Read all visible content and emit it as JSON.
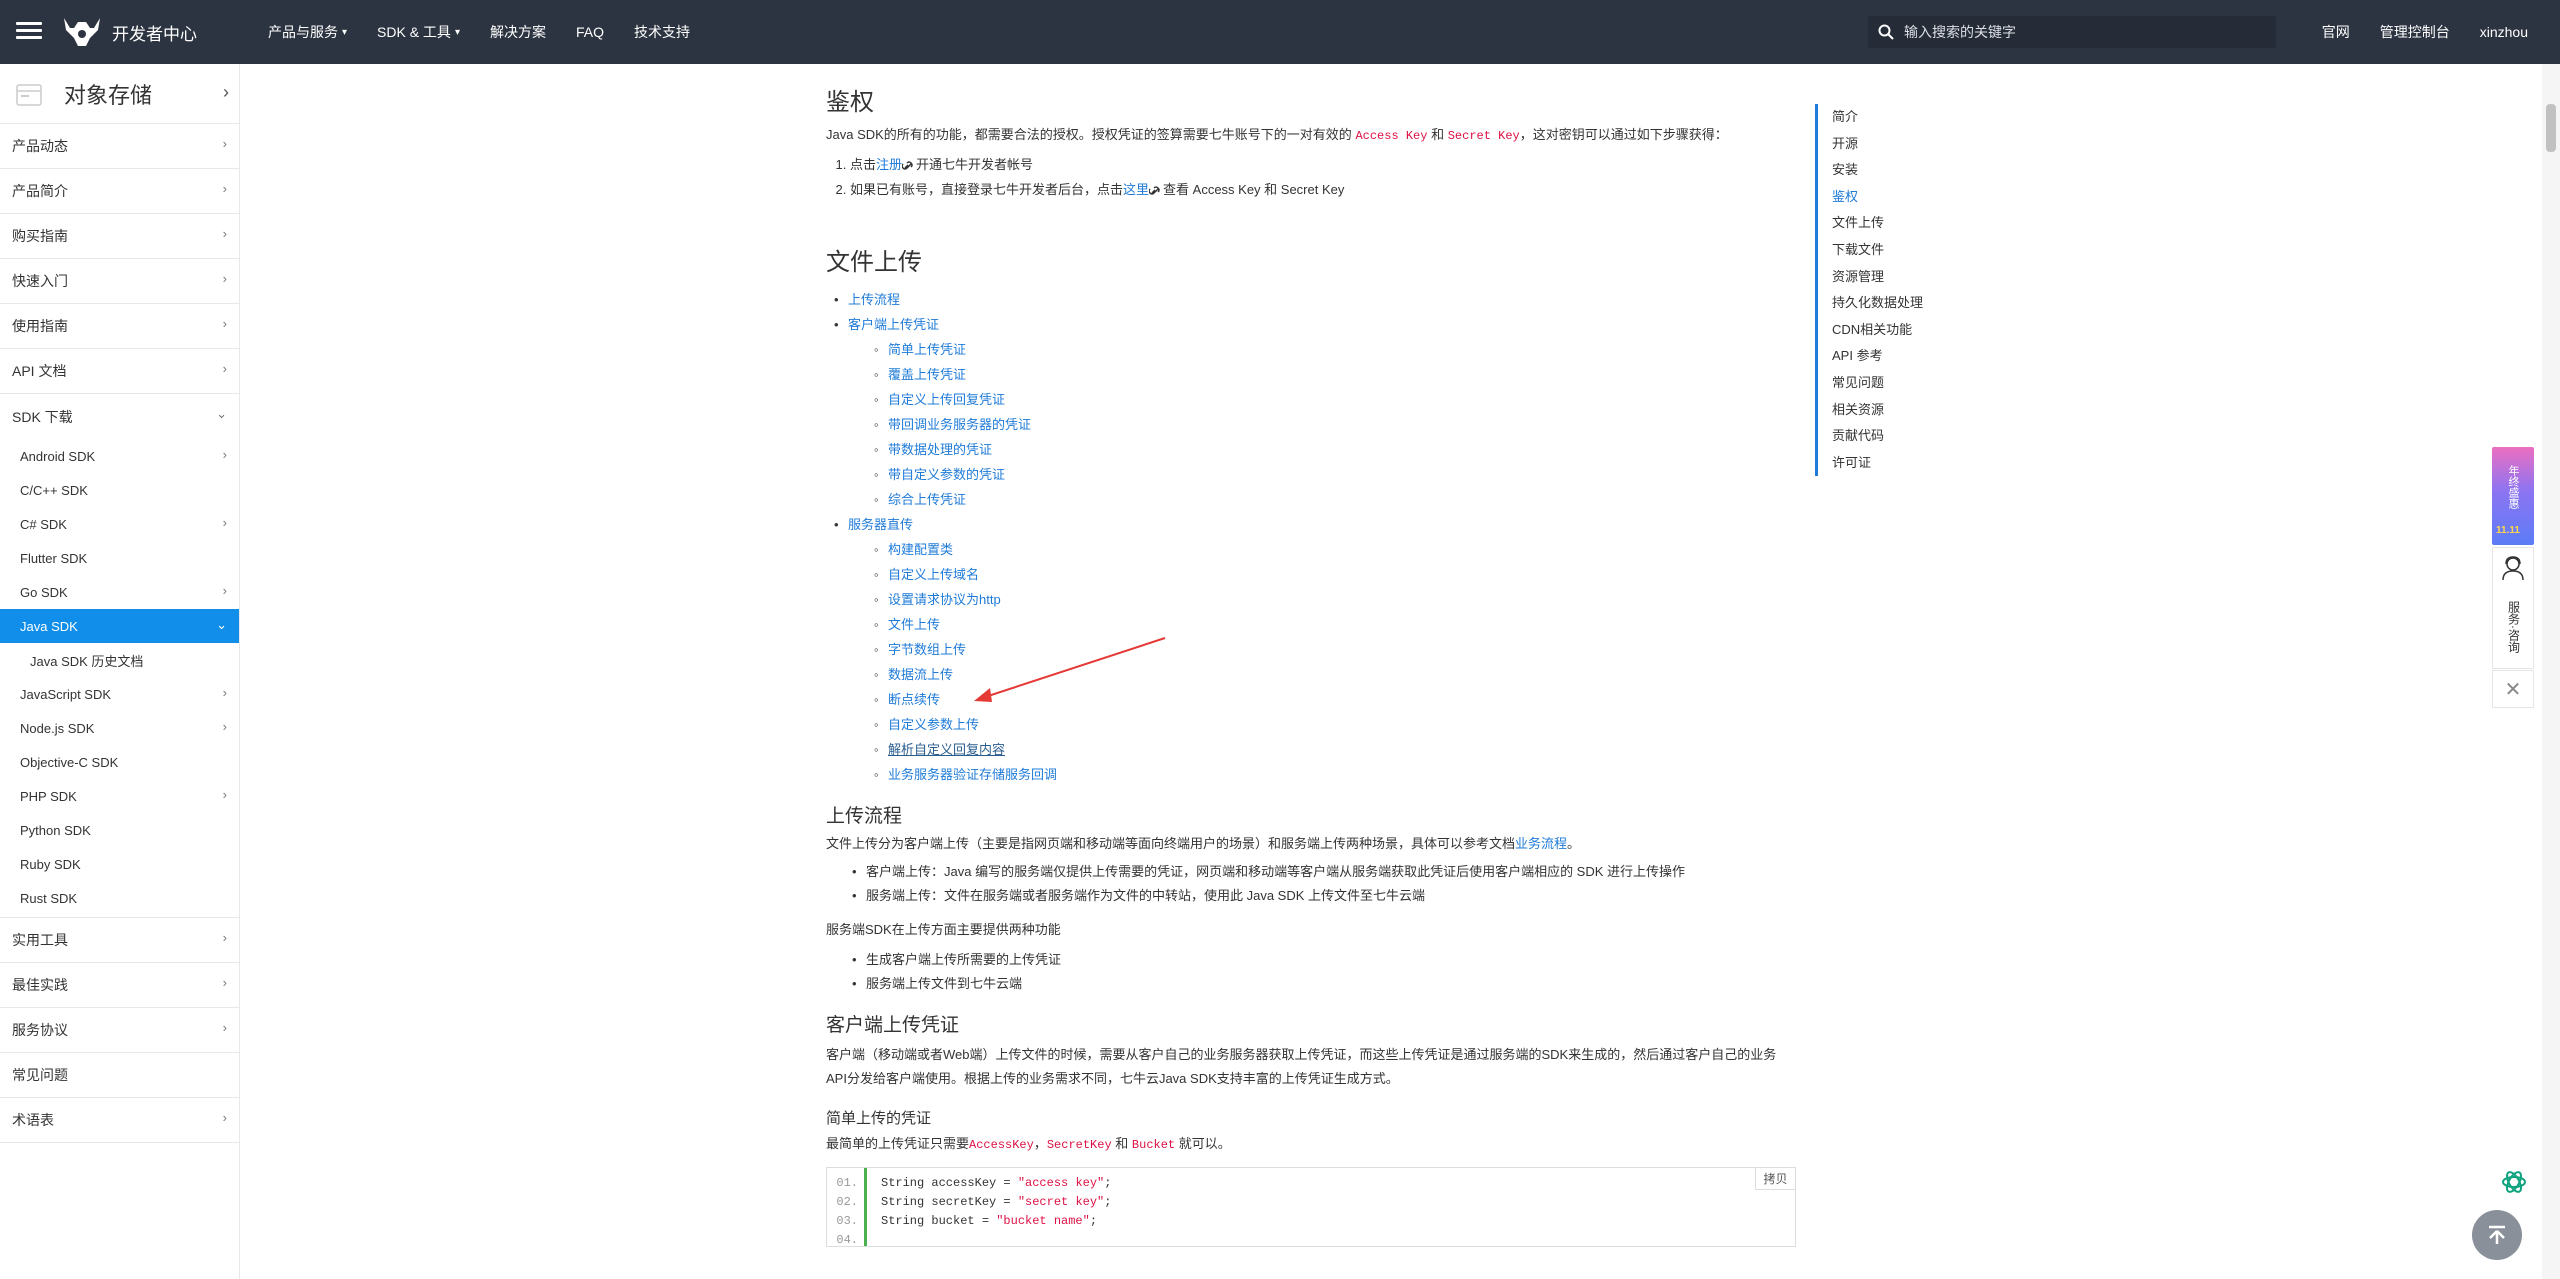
{
  "nav": {
    "logo_text": "开发者中心",
    "items": [
      "产品与服务",
      "SDK & 工具",
      "解决方案",
      "FAQ",
      "技术支持"
    ],
    "search_placeholder": "输入搜索的关键字",
    "right": [
      "官网",
      "管理控制台",
      "xinzhou"
    ]
  },
  "sidebar": {
    "title": "对象存储",
    "items_top": [
      "产品动态",
      "产品简介",
      "购买指南",
      "快速入门",
      "使用指南",
      "API 文档"
    ],
    "sdk_label": "SDK 下载",
    "sdk_items": [
      "Android SDK",
      "C/C++ SDK",
      "C# SDK",
      "Flutter SDK",
      "Go SDK"
    ],
    "active_item": "Java SDK",
    "active_sub": "Java SDK 历史文档",
    "sdk_items_after": [
      "JavaScript SDK",
      "Node.js SDK",
      "Objective-C SDK",
      "PHP SDK",
      "Python SDK",
      "Ruby SDK",
      "Rust SDK"
    ],
    "items_bottom": [
      "实用工具",
      "最佳实践",
      "服务协议",
      "常见问题",
      "术语表"
    ]
  },
  "content": {
    "auth_title": "鉴权",
    "auth_p1_before": "Java SDK的所有的功能，都需要合法的授权。授权凭证的签算需要七牛账号下的一对有效的",
    "access_key": "Access Key",
    "and": "和",
    "secret_key": "Secret Key",
    "auth_p1_after": "，这对密钥可以通过如下步骤获得：",
    "step1_a": "点击",
    "step1_link": "注册",
    "step1_b": "开通七牛开发者帐号",
    "step2_a": "如果已有账号，直接登录七牛开发者后台，点击",
    "step2_link": "这里",
    "step2_b": "查看 Access Key 和 Secret Key",
    "upload_title": "文件上传",
    "toc_l1": [
      "上传流程",
      "客户端上传凭证"
    ],
    "toc_client": [
      "简单上传凭证",
      "覆盖上传凭证",
      "自定义上传回复凭证",
      "带回调业务服务器的凭证",
      "带数据处理的凭证",
      "带自定义参数的凭证",
      "综合上传凭证"
    ],
    "toc_server_label": "服务器直传",
    "toc_server": [
      "构建配置类",
      "自定义上传域名",
      "设置请求协议为http",
      "文件上传",
      "字节数组上传",
      "数据流上传",
      "断点续传",
      "自定义参数上传",
      "解析自定义回复内容",
      "业务服务器验证存储服务回调"
    ],
    "flow_title": "上传流程",
    "flow_p_before": "文件上传分为客户端上传（主要是指网页端和移动端等面向终端用户的场景）和服务端上传两种场景，具体可以参考文档",
    "flow_p_link": "业务流程",
    "flow_p_after": "。",
    "flow_list": [
      "客户端上传：Java 编写的服务端仅提供上传需要的凭证，网页端和移动端等客户端从服务端获取此凭证后使用客户端相应的 SDK 进行上传操作",
      "服务端上传：文件在服务端或者服务端作为文件的中转站，使用此 Java SDK 上传文件至七牛云端"
    ],
    "server_p": "服务端SDK在上传方面主要提供两种功能",
    "server_list": [
      "生成客户端上传所需要的上传凭证",
      "服务端上传文件到七牛云端"
    ],
    "client_token_title": "客户端上传凭证",
    "client_token_p": "客户端（移动端或者Web端）上传文件的时候，需要从客户自己的业务服务器获取上传凭证，而这些上传凭证是通过服务端的SDK来生成的，然后通过客户自己的业务API分发给客户端使用。根据上传的业务需求不同，七牛云Java SDK支持丰富的上传凭证生成方式。",
    "simple_title": "简单上传的凭证",
    "simple_p_before": "最简单的上传凭证只需要",
    "simple_code1": "AccessKey",
    "simple_comma": "，",
    "simple_code2": "SecretKey",
    "simple_and": "和",
    "simple_code3": "Bucket",
    "simple_p_after": "就可以。",
    "code_line_nums": [
      "01.",
      "02.",
      "03.",
      "04."
    ],
    "code_lines": [
      {
        "pre": "String accessKey = ",
        "str": "\"access key\"",
        "post": ";"
      },
      {
        "pre": "String secretKey = ",
        "str": "\"secret key\"",
        "post": ";"
      },
      {
        "pre": "String bucket = ",
        "str": "\"bucket name\"",
        "post": ";"
      }
    ],
    "copy_label": "拷贝"
  },
  "toc": [
    "简介",
    "开源",
    "安装",
    "鉴权",
    "文件上传",
    "下载文件",
    "资源管理",
    "持久化数据处理",
    "CDN相关功能",
    "API 参考",
    "常见问题",
    "相关资源",
    "贡献代码",
    "许可证"
  ],
  "toc_active": "鉴权",
  "float": {
    "banner_text": "年终盛惠",
    "banner_badge": "11.11",
    "service_text": "服务·咨询"
  },
  "colors": {
    "nav_bg": "#2d3441",
    "accent": "#108ee9",
    "link": "#1f7bd8",
    "code_red": "#dd1144"
  }
}
